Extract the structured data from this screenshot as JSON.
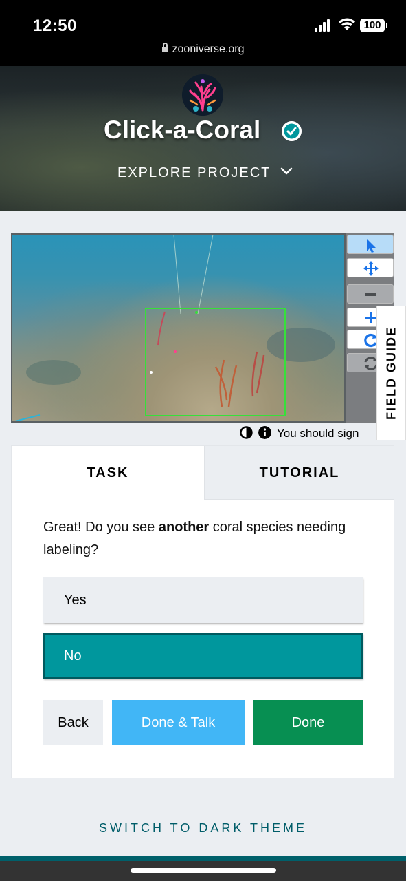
{
  "status_bar": {
    "time": "12:50",
    "battery": "100",
    "url": "zooniverse.org"
  },
  "project": {
    "title": "Click-a-Coral",
    "explore_label": "EXPLORE PROJECT",
    "verified": true
  },
  "viewer": {
    "tools": [
      {
        "name": "pointer-icon",
        "active": true
      },
      {
        "name": "move-icon",
        "active": false
      },
      {
        "name": "zoom-out-icon",
        "disabled": true
      },
      {
        "name": "zoom-in-icon",
        "active": false
      },
      {
        "name": "rotate-icon",
        "active": false
      },
      {
        "name": "reset-icon",
        "disabled": true
      }
    ],
    "field_guide_label": "FIELD GUIDE",
    "meta_text": "You should sign"
  },
  "task_panel": {
    "tabs": [
      {
        "label": "TASK",
        "active": true
      },
      {
        "label": "TUTORIAL",
        "active": false
      }
    ],
    "question": {
      "before": "Great! Do you see ",
      "bold": "another",
      "after": " coral species needing labeling?"
    },
    "answers": [
      {
        "label": "Yes",
        "selected": false
      },
      {
        "label": "No",
        "selected": true
      }
    ],
    "buttons": {
      "back": "Back",
      "done_talk": "Done & Talk",
      "done": "Done"
    }
  },
  "footer": {
    "dark_theme_label": "SWITCH TO DARK THEME"
  },
  "colors": {
    "teal_accent": "#00979d",
    "done_green": "#078f52",
    "talk_blue": "#41b6f6",
    "bounding_box": "#36e03a"
  }
}
